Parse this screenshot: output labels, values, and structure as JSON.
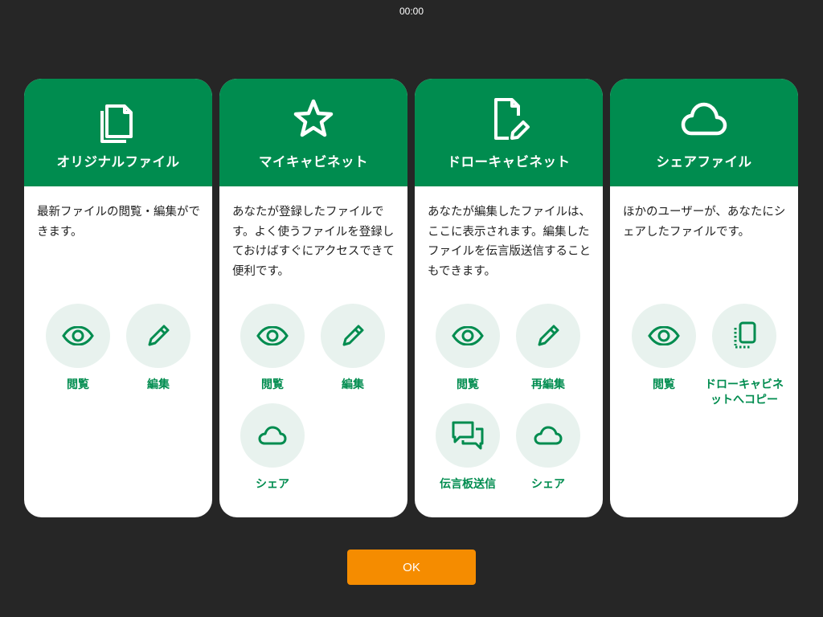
{
  "status_bar": {
    "time": "00:00"
  },
  "cards": [
    {
      "icon": "copy-files-icon",
      "title": "オリジナルファイル",
      "description": "最新ファイルの閲覧・編集ができます。",
      "actions": [
        {
          "icon": "eye-icon",
          "label": "閲覧"
        },
        {
          "icon": "pencil-icon",
          "label": "編集"
        }
      ]
    },
    {
      "icon": "star-icon",
      "title": "マイキャビネット",
      "description": "あなたが登録したファイルです。よく使うファイルを登録しておけばすぐにアクセスできて便利です。",
      "actions": [
        {
          "icon": "eye-icon",
          "label": "閲覧"
        },
        {
          "icon": "pencil-icon",
          "label": "編集"
        },
        {
          "icon": "cloud-icon",
          "label": "シェア"
        }
      ]
    },
    {
      "icon": "file-edit-icon",
      "title": "ドローキャビネット",
      "description": "あなたが編集したファイルは、ここに表示されます。編集したファイルを伝言版送信することもできます。",
      "actions": [
        {
          "icon": "eye-icon",
          "label": "閲覧"
        },
        {
          "icon": "pencil-icon",
          "label": "再編集"
        },
        {
          "icon": "chat-bubbles-icon",
          "label": "伝言板送信"
        },
        {
          "icon": "cloud-icon",
          "label": "シェア"
        }
      ]
    },
    {
      "icon": "cloud-icon",
      "title": "シェアファイル",
      "description": "ほかのユーザーが、あなたにシェアしたファイルです。",
      "actions": [
        {
          "icon": "eye-icon",
          "label": "閲覧"
        },
        {
          "icon": "copy-to-cabinet-icon",
          "label": "ドローキャビネットへコピー"
        }
      ]
    }
  ],
  "ok_button": {
    "label": "OK"
  },
  "colors": {
    "background": "#262626",
    "header_green": "#008c4f",
    "action_circle": "#e8f2ee",
    "ok_orange": "#f58c00"
  }
}
